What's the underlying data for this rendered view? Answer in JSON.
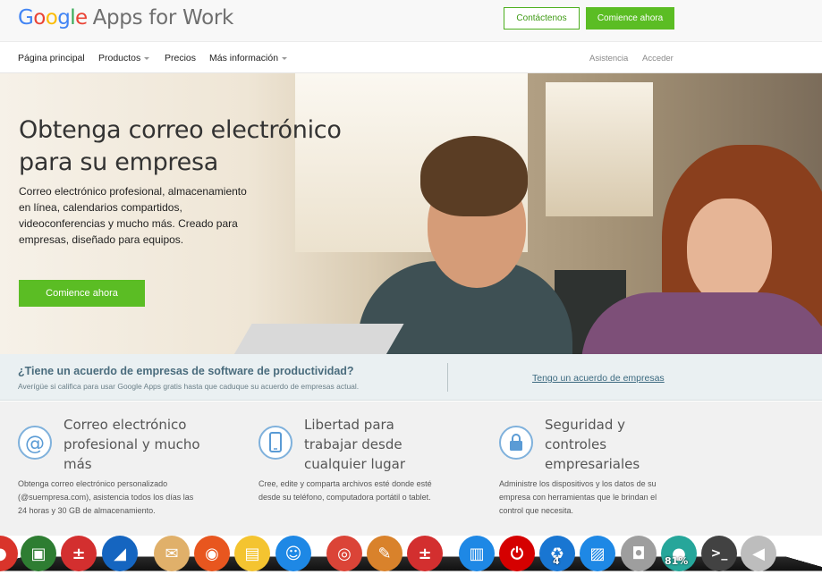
{
  "header": {
    "logo_word": [
      "G",
      "o",
      "o",
      "g",
      "l",
      "e"
    ],
    "product_name": "Apps for Work",
    "contact_button": "Contáctenos",
    "start_button": "Comience ahora"
  },
  "nav": {
    "items": [
      {
        "label": "Página principal",
        "has_dropdown": false
      },
      {
        "label": "Productos",
        "has_dropdown": true
      },
      {
        "label": "Precios",
        "has_dropdown": false
      },
      {
        "label": "Más información",
        "has_dropdown": true
      }
    ],
    "right_links": [
      "Asistencia",
      "Acceder"
    ]
  },
  "hero": {
    "title_line1": "Obtenga correo electrónico",
    "title_line2": "para su empresa",
    "description": "Correo electrónico profesional, almacenamiento en línea, calendarios compartidos, videoconferencias y mucho más. Creado para empresas, diseñado para equipos.",
    "cta": "Comience ahora"
  },
  "agreement": {
    "question": "¿Tiene un acuerdo de empresas de software de productividad?",
    "subtitle": "Averígüe si califica para usar Google Apps gratis hasta que caduque su acuerdo de empresas actual.",
    "link": "Tengo un acuerdo de empresas"
  },
  "features": [
    {
      "icon": "at-sign-icon",
      "title": "Correo electrónico profesional y mucho más",
      "description": "Obtenga correo electrónico personalizado (@suempresa.com), asistencia todos los días las 24 horas y 30 GB de almacenamiento."
    },
    {
      "icon": "phone-icon",
      "title": "Libertad para trabajar desde cualquier lugar",
      "description": "Cree, edite y comparta archivos esté donde esté desde su teléfono, computadora portátil o tablet."
    },
    {
      "icon": "lock-icon",
      "title": "Seguridad y controles empresariales",
      "description": "Administre los dispositivos y los datos de su empresa con herramientas que le brindan el control que necesita."
    }
  ],
  "dock": {
    "apps": [
      {
        "name": "app-icon-partial",
        "color": "#d9342b"
      },
      {
        "name": "image-viewer-icon",
        "color": "#2e7d32"
      },
      {
        "name": "calculator-icon",
        "color": "#d32f2f"
      },
      {
        "name": "tool-icon",
        "color": "#1565c0"
      },
      {
        "name": "mail-icon",
        "color": "#e0b06a"
      },
      {
        "name": "firefox-icon",
        "color": "#e8561f"
      },
      {
        "name": "files-icon",
        "color": "#f4c430"
      },
      {
        "name": "chat-icon",
        "color": "#1e88e5"
      },
      {
        "name": "chrome-icon",
        "color": "#db4437"
      },
      {
        "name": "notes-icon",
        "color": "#d9822b"
      },
      {
        "name": "calculator-2-icon",
        "color": "#d32f2f"
      },
      {
        "name": "folder-icon",
        "color": "#1e88e5"
      },
      {
        "name": "power-icon",
        "color": "#d50000"
      },
      {
        "name": "recycle-icon",
        "color": "#1976d2"
      },
      {
        "name": "pictures-icon",
        "color": "#1e88e5"
      },
      {
        "name": "camera-icon",
        "color": "#9e9e9e"
      },
      {
        "name": "globe-icon",
        "color": "#26a69a"
      },
      {
        "name": "terminal-icon",
        "color": "#424242"
      },
      {
        "name": "speaker-icon",
        "color": "#bdbdbd"
      }
    ],
    "trash_badge": "4",
    "globe_badge": "81%"
  },
  "colors": {
    "accent_green": "#5bbd24",
    "link_blue": "#3c6a80",
    "icon_blue": "#7fb1dc"
  }
}
